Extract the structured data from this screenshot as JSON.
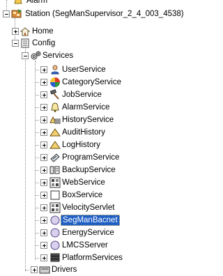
{
  "tree": {
    "top_partial": {
      "label": "Alarm",
      "icon": "alarm-bell-icon"
    },
    "station": {
      "label": "Station (SegManSupervisor_2_4_003_4538)",
      "icon": "station-icon"
    },
    "home": {
      "label": "Home",
      "icon": "home-icon"
    },
    "config": {
      "label": "Config",
      "icon": "config-icon"
    },
    "services": {
      "label": "Services",
      "icon": "services-gear-icon"
    },
    "service_items": [
      {
        "label": "UserService",
        "icon": "user-icon"
      },
      {
        "label": "CategoryService",
        "icon": "category-pie-icon"
      },
      {
        "label": "JobService",
        "icon": "hammer-icon"
      },
      {
        "label": "AlarmService",
        "icon": "bell-icon"
      },
      {
        "label": "HistoryService",
        "icon": "history-icon"
      },
      {
        "label": "AuditHistory",
        "icon": "triangle-icon"
      },
      {
        "label": "LogHistory",
        "icon": "triangle-icon"
      },
      {
        "label": "ProgramService",
        "icon": "program-icon"
      },
      {
        "label": "BackupService",
        "icon": "backup-icon"
      },
      {
        "label": "WebService",
        "icon": "web-icon"
      },
      {
        "label": "BoxService",
        "icon": "box-icon"
      },
      {
        "label": "VelocityServlet",
        "icon": "velocity-icon"
      },
      {
        "label": "SegManBacnet",
        "icon": "circle-icon",
        "selected": true
      },
      {
        "label": "EnergyService",
        "icon": "circle-icon"
      },
      {
        "label": "LMCSServer",
        "icon": "circle-icon"
      },
      {
        "label": "PlatformServices",
        "icon": "platform-stack-icon"
      }
    ],
    "drivers": {
      "label": "Drivers",
      "icon": "drivers-icon"
    }
  },
  "colors": {
    "selection_bg": "#1f5fc4",
    "selection_text": "#ffffff",
    "tree_lines": "#8a8a8a"
  }
}
